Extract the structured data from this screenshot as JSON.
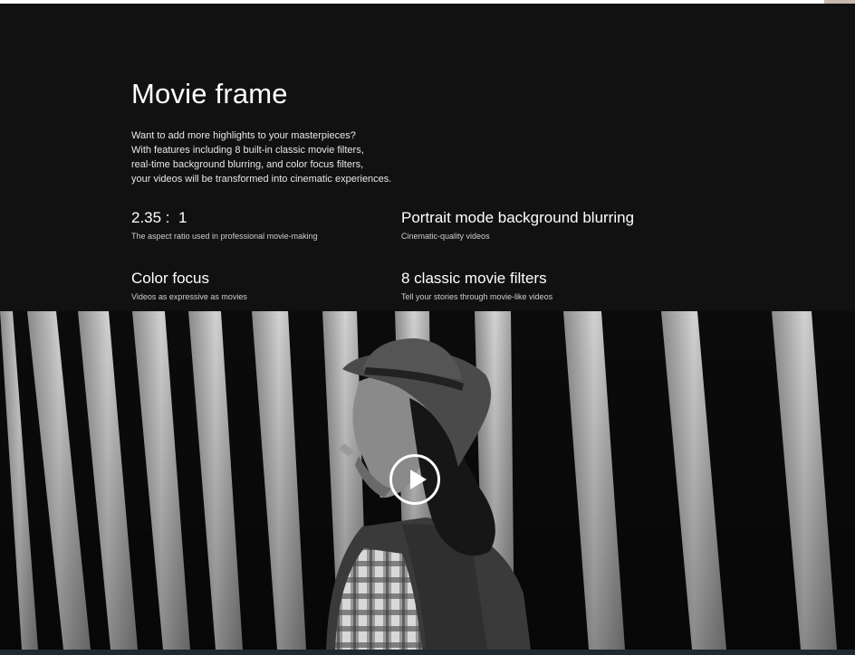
{
  "section": {
    "title": "Movie frame",
    "description": [
      "Want to add more highlights to your masterpieces?",
      "With features including 8 built-in classic movie filters,",
      "real-time background blurring, and color focus filters,",
      "your videos will be transformed into cinematic experiences."
    ],
    "features": [
      {
        "title": "2.35 :  1",
        "subtitle": "The aspect ratio used in professional movie-making"
      },
      {
        "title": "Portrait mode background blurring",
        "subtitle": "Cinematic-quality videos"
      },
      {
        "title": "Color focus",
        "subtitle": "Videos as expressive as movies"
      },
      {
        "title": "8 classic movie filters",
        "subtitle": "Tell your stories through movie-like videos"
      }
    ]
  },
  "video": {
    "play_icon": "play-icon"
  },
  "colors": {
    "section_background": "#111111",
    "text_primary": "#ffffff",
    "text_secondary": "#cfcfcf"
  }
}
